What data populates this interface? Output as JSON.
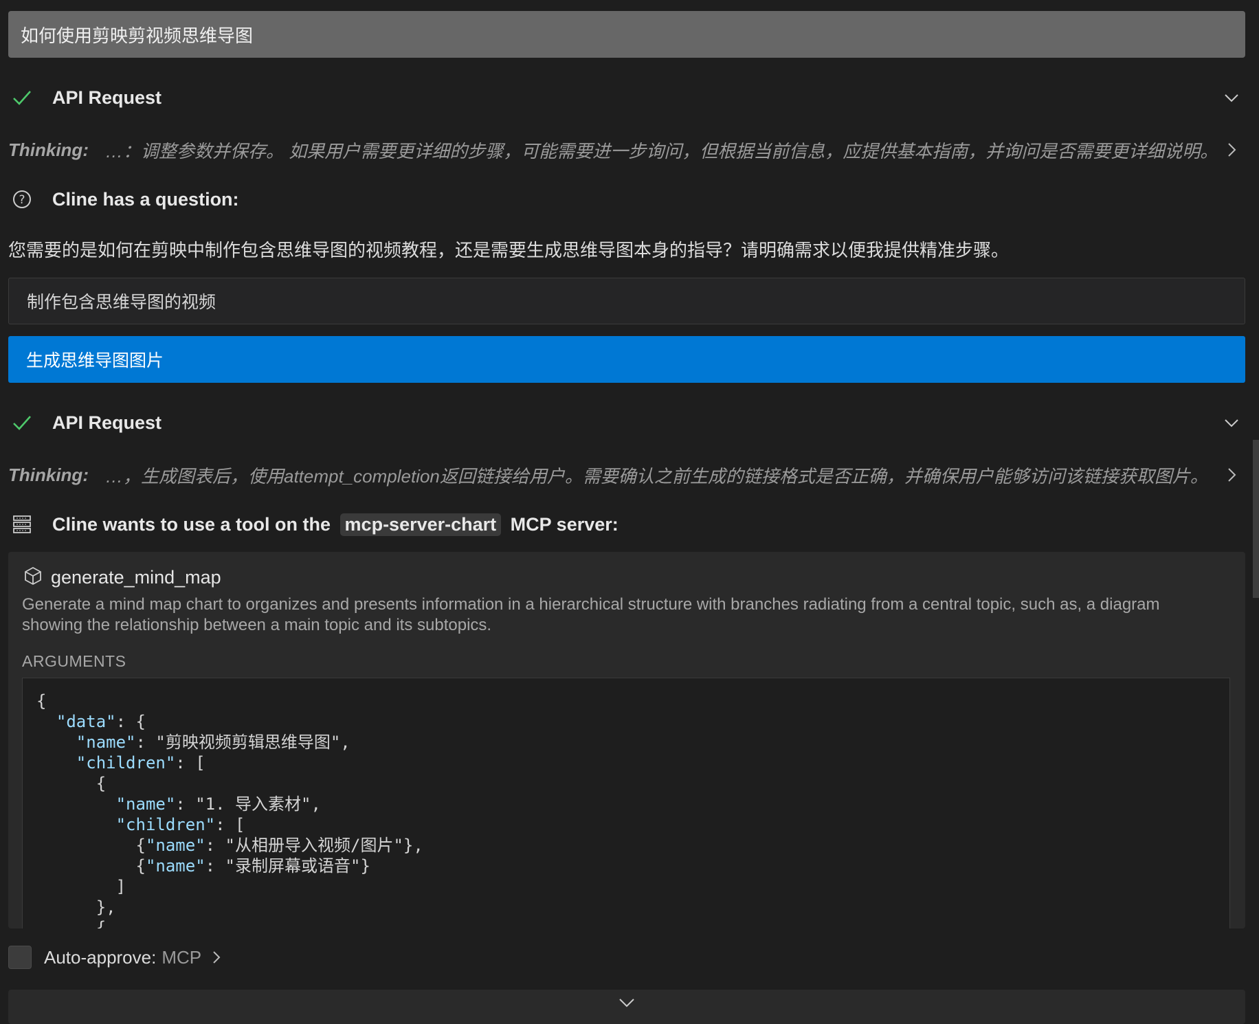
{
  "task": {
    "text": "如何使用剪映剪视频思维导图"
  },
  "blocks": [
    {
      "title": "API Request"
    },
    {
      "thinking_label": "Thinking:",
      "thinking_text": "…：调整参数并保存。 如果用户需要更详细的步骤，可能需要进一步询问，但根据当前信息，应提供基本指南，并询问是否需要更详细说明。"
    },
    {
      "title": "Cline has a question:"
    },
    {
      "title": "API Request"
    },
    {
      "thinking_label": "Thinking:",
      "thinking_text": "…，生成图表后，使用attempt_completion返回链接给用户。需要确认之前生成的链接格式是否正确，并确保用户能够访问该链接获取图片。"
    }
  ],
  "question": {
    "text": "您需要的是如何在剪映中制作包含思维导图的视频教程，还是需要生成思维导图本身的指导？请明确需求以便我提供精准步骤。",
    "options": [
      "制作包含思维导图的视频",
      "生成思维导图图片"
    ]
  },
  "mcp": {
    "prefix": "Cline wants to use a tool on the",
    "server": "mcp-server-chart",
    "suffix": "MCP server:",
    "tool_name": "generate_mind_map",
    "description": "Generate a mind map chart to organizes and presents information in a hierarchical structure with branches radiating from a central topic, such as, a diagram showing the relationship between a main topic and its subtopics.",
    "arguments_label": "ARGUMENTS",
    "code_lines": [
      "{",
      "  \"data\": {",
      "    \"name\": \"剪映视频剪辑思维导图\",",
      "    \"children\": [",
      "      {",
      "        \"name\": \"1. 导入素材\",",
      "        \"children\": [",
      "          {\"name\": \"从相册导入视频/图片\"},",
      "          {\"name\": \"录制屏幕或语音\"}",
      "        ]",
      "      },",
      "      {"
    ]
  },
  "auto_approve": {
    "label": "Auto-approve:",
    "value": "MCP"
  },
  "icons": {
    "check": "check-icon",
    "chevron_down": "chevron-down-icon",
    "chevron_right": "chevron-right-icon",
    "question": "question-circle-icon",
    "server": "server-icon",
    "tool": "package-icon"
  },
  "colors": {
    "accent": "#0078d4",
    "check": "#4ec96b",
    "json_key": "#9cdcfe"
  }
}
